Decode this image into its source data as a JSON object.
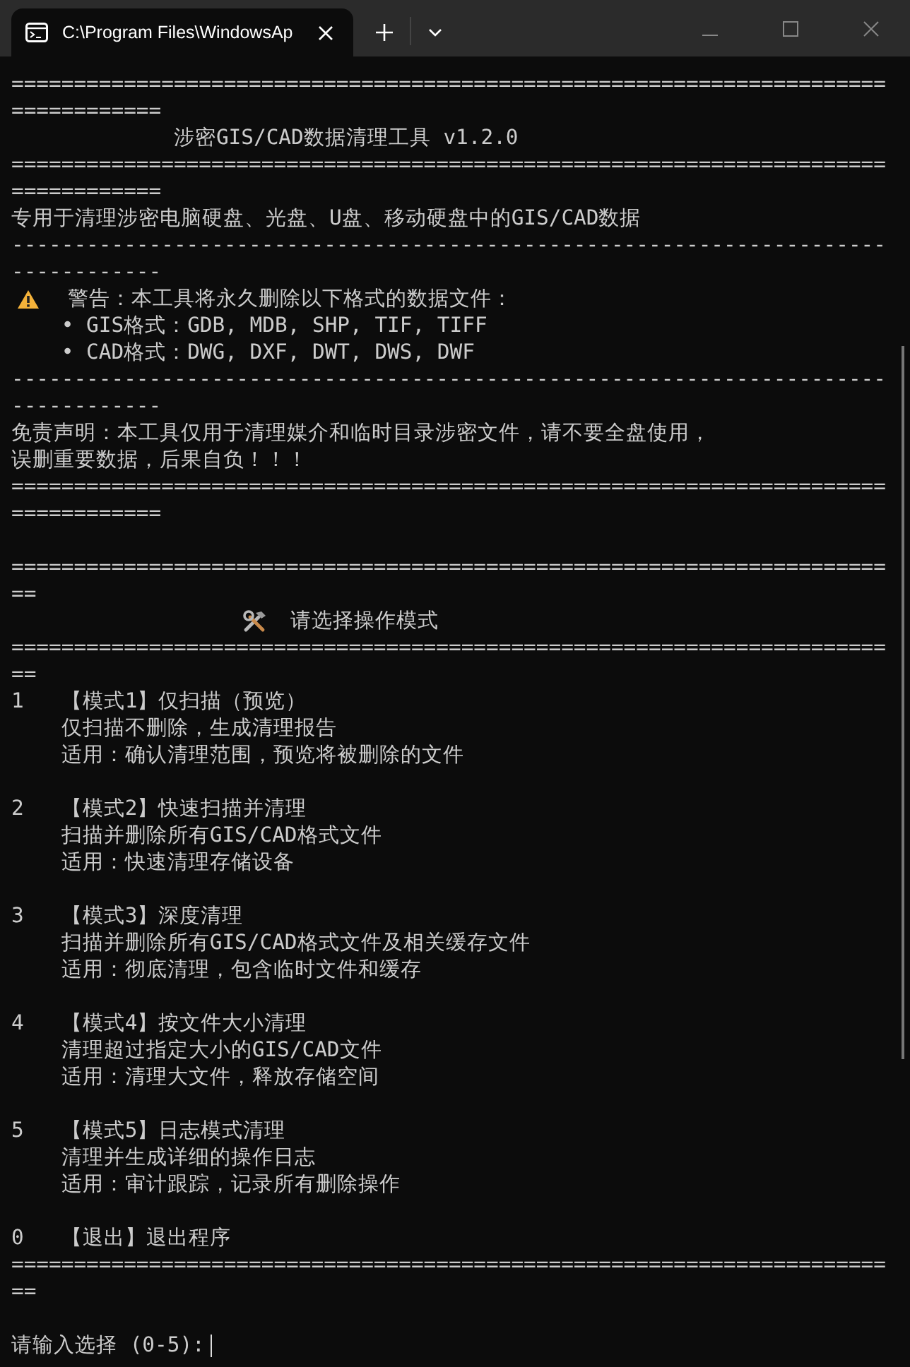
{
  "window": {
    "tab": {
      "title": "C:\\Program Files\\WindowsAp",
      "selected": true
    }
  },
  "console": {
    "lines": [
      {
        "kind": "rule",
        "text": "======================================================================"
      },
      {
        "kind": "rule",
        "text": "============"
      },
      {
        "kind": "title",
        "text": "涉密GIS/CAD数据清理工具 v1.2.0"
      },
      {
        "kind": "rule",
        "text": "======================================================================"
      },
      {
        "kind": "rule",
        "text": "============"
      },
      {
        "kind": "text",
        "text": "专用于清理涉密电脑硬盘、光盘、U盘、移动硬盘中的GIS/CAD数据"
      },
      {
        "kind": "rule",
        "text": "----------------------------------------------------------------------"
      },
      {
        "kind": "rule",
        "text": "------------"
      },
      {
        "kind": "warning",
        "text": "警告：本工具将永久删除以下格式的数据文件："
      },
      {
        "kind": "bullet",
        "text": "• GIS格式：GDB, MDB, SHP, TIF, TIFF"
      },
      {
        "kind": "bullet",
        "text": "• CAD格式：DWG, DXF, DWT, DWS, DWF"
      },
      {
        "kind": "rule",
        "text": "----------------------------------------------------------------------"
      },
      {
        "kind": "rule",
        "text": "------------"
      },
      {
        "kind": "text",
        "text": "免责声明：本工具仅用于清理媒介和临时目录涉密文件，请不要全盘使用，"
      },
      {
        "kind": "text",
        "text": "误删重要数据，后果自负！！！"
      },
      {
        "kind": "rule",
        "text": "======================================================================"
      },
      {
        "kind": "rule",
        "text": "============"
      },
      {
        "kind": "blank"
      },
      {
        "kind": "rule",
        "text": "======================================================================"
      },
      {
        "kind": "rule",
        "text": "=="
      },
      {
        "kind": "heading",
        "text": "请选择操作模式"
      },
      {
        "kind": "rule",
        "text": "======================================================================"
      },
      {
        "kind": "rule",
        "text": "=="
      },
      {
        "kind": "option",
        "key": "1",
        "text": "【模式1】仅扫描（预览）"
      },
      {
        "kind": "detail",
        "text": "仅扫描不删除，生成清理报告"
      },
      {
        "kind": "detail",
        "text": "适用：确认清理范围，预览将被删除的文件"
      },
      {
        "kind": "blank"
      },
      {
        "kind": "option",
        "key": "2",
        "text": "【模式2】快速扫描并清理"
      },
      {
        "kind": "detail",
        "text": "扫描并删除所有GIS/CAD格式文件"
      },
      {
        "kind": "detail",
        "text": "适用：快速清理存储设备"
      },
      {
        "kind": "blank"
      },
      {
        "kind": "option",
        "key": "3",
        "text": "【模式3】深度清理"
      },
      {
        "kind": "detail",
        "text": "扫描并删除所有GIS/CAD格式文件及相关缓存文件"
      },
      {
        "kind": "detail",
        "text": "适用：彻底清理，包含临时文件和缓存"
      },
      {
        "kind": "blank"
      },
      {
        "kind": "option",
        "key": "4",
        "text": "【模式4】按文件大小清理"
      },
      {
        "kind": "detail",
        "text": "清理超过指定大小的GIS/CAD文件"
      },
      {
        "kind": "detail",
        "text": "适用：清理大文件，释放存储空间"
      },
      {
        "kind": "blank"
      },
      {
        "kind": "option",
        "key": "5",
        "text": "【模式5】日志模式清理"
      },
      {
        "kind": "detail",
        "text": "清理并生成详细的操作日志"
      },
      {
        "kind": "detail",
        "text": "适用：审计跟踪，记录所有删除操作"
      },
      {
        "kind": "blank"
      },
      {
        "kind": "option",
        "key": "0",
        "text": "【退出】退出程序"
      },
      {
        "kind": "rule",
        "text": "======================================================================"
      },
      {
        "kind": "rule",
        "text": "=="
      },
      {
        "kind": "blank"
      },
      {
        "kind": "prompt",
        "text": "请输入选择 (0-5):"
      }
    ]
  }
}
